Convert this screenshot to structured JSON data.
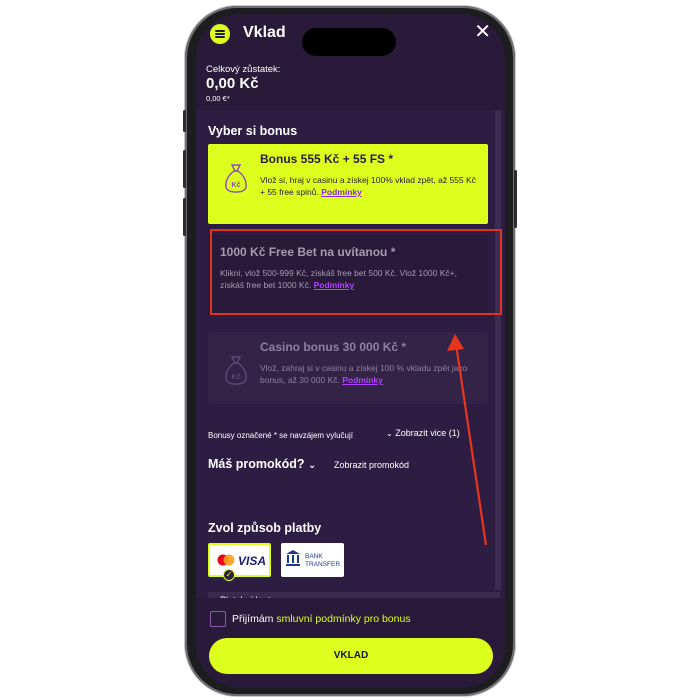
{
  "header": {
    "title": "Vklad",
    "close_symbol": "✕"
  },
  "balance": {
    "label": "Celkový zůstatek:",
    "value": "0,00 Kč",
    "eur": "0,00 €*"
  },
  "bonus_section": {
    "title": "Vyber si bonus",
    "items": [
      {
        "title": "Bonus 555 Kč + 55 FS",
        "asterisk": "*",
        "text": "Vlož si, hraj v casinu a získej 100% vklad zpět, až 555 Kč + 55 free spinů.",
        "link": "Podmínky",
        "icon": "money-bag-icon",
        "bag_label": "Kč",
        "selected": true
      },
      {
        "title": "1000 Kč Free Bet na uvítanou",
        "asterisk": "*",
        "text": "Klikni, vlož 500-999 Kč, získáš free bet 500 Kč. Vlož 1000 Kč+, získáš free bet 1000 Kč.",
        "link": "Podmínky",
        "selected": false
      },
      {
        "title": "Casino bonus 30 000 Kč",
        "asterisk": "*",
        "text": "Vlož, zahraj si v casinu a získej 100 % vkladu zpět jako bonus, až 30 000 Kč.",
        "link": "Podmínky",
        "icon": "money-bag-icon",
        "bag_label": "Kč",
        "selected": false
      }
    ],
    "exclusive_note": "Bonusy označené * se navzájem vylučují",
    "show_all": "Zobrazit vice (1)"
  },
  "promo": {
    "title": "Máš promokód?",
    "show": "Zobrazit promokód"
  },
  "payment": {
    "title": "Zvol způsob platby",
    "methods": [
      {
        "name": "VISA",
        "icon": "mastercard-visa-icon",
        "selected": true
      },
      {
        "name_line1": "BANK",
        "name_line2": "TRANSFER",
        "icon": "bank-icon",
        "selected": false
      }
    ],
    "current_method": "Platební karta"
  },
  "footer": {
    "accept_prefix": "Přijímám",
    "accept_link": "smluvní podmínky pro bonus",
    "cta": "VKLAD"
  },
  "colors": {
    "accent": "#dcff1e",
    "background": "#2e1d42",
    "highlight_outline": "#e2341d",
    "link": "#b042ff"
  }
}
